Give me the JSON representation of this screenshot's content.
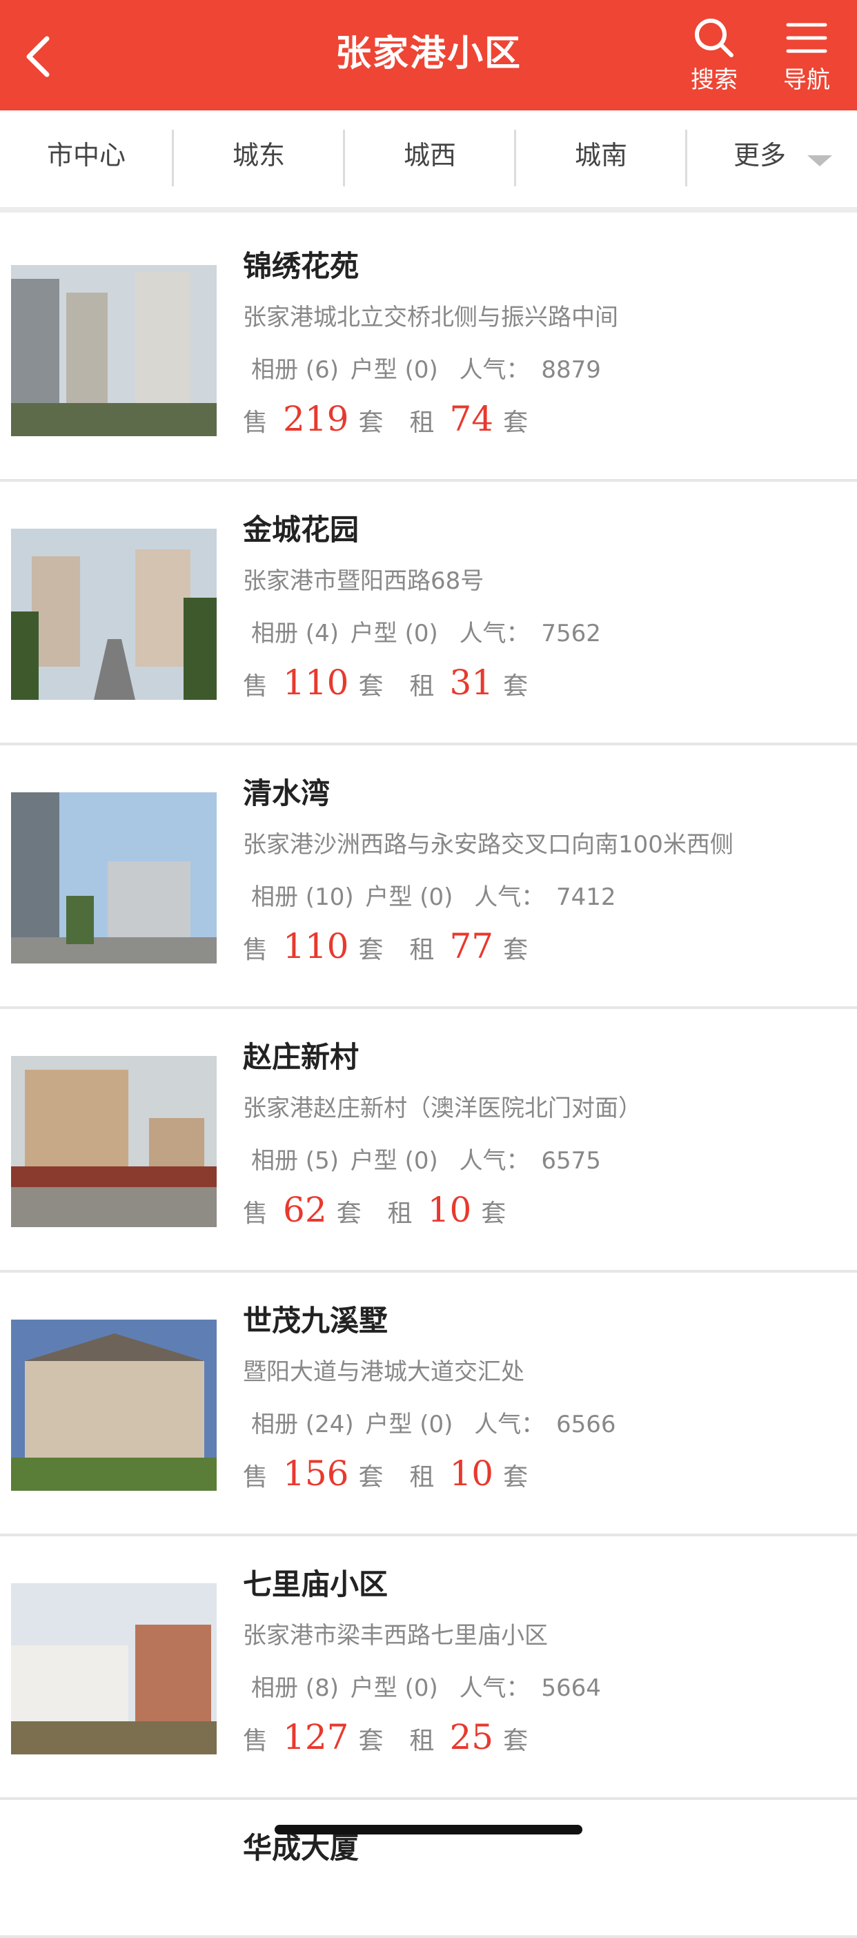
{
  "header": {
    "title": "张家港小区",
    "search_label": "搜索",
    "nav_label": "导航"
  },
  "tabs": [
    "市中心",
    "城东",
    "城西",
    "城南",
    "更多"
  ],
  "items": [
    {
      "name": "锦绣花苑",
      "address": "张家港城北立交桥北侧与振兴路中间",
      "album": "相册 (6)",
      "layouts": "户型 (0)",
      "pop_label": "人气：",
      "popularity": "8879",
      "sale_label": "售",
      "sale": "219",
      "rent_label": "租",
      "rent": "74",
      "unit": "套"
    },
    {
      "name": "金城花园",
      "address": "张家港市暨阳西路68号",
      "album": "相册 (4)",
      "layouts": "户型 (0)",
      "pop_label": "人气：",
      "popularity": "7562",
      "sale_label": "售",
      "sale": "110",
      "rent_label": "租",
      "rent": "31",
      "unit": "套"
    },
    {
      "name": "清水湾",
      "address": "张家港沙洲西路与永安路交叉口向南100米西侧",
      "album": "相册 (10)",
      "layouts": "户型 (0)",
      "pop_label": "人气：",
      "popularity": "7412",
      "sale_label": "售",
      "sale": "110",
      "rent_label": "租",
      "rent": "77",
      "unit": "套"
    },
    {
      "name": "赵庄新村",
      "address": "张家港赵庄新村（澳洋医院北门对面）",
      "album": "相册 (5)",
      "layouts": "户型 (0)",
      "pop_label": "人气：",
      "popularity": "6575",
      "sale_label": "售",
      "sale": "62",
      "rent_label": "租",
      "rent": "10",
      "unit": "套"
    },
    {
      "name": "世茂九溪墅",
      "address": "暨阳大道与港城大道交汇处",
      "album": "相册 (24)",
      "layouts": "户型 (0)",
      "pop_label": "人气：",
      "popularity": "6566",
      "sale_label": "售",
      "sale": "156",
      "rent_label": "租",
      "rent": "10",
      "unit": "套"
    },
    {
      "name": "七里庙小区",
      "address": "张家港市梁丰西路七里庙小区",
      "album": "相册 (8)",
      "layouts": "户型 (0)",
      "pop_label": "人气：",
      "popularity": "5664",
      "sale_label": "售",
      "sale": "127",
      "rent_label": "租",
      "rent": "25",
      "unit": "套"
    },
    {
      "name": "华成大厦"
    }
  ],
  "colors": {
    "brand": "#ee4534",
    "price": "#e8392e"
  },
  "icons": {
    "back": "chevron-left-icon",
    "search": "search-icon",
    "nav": "menu-icon",
    "more": "caret-down-icon"
  }
}
